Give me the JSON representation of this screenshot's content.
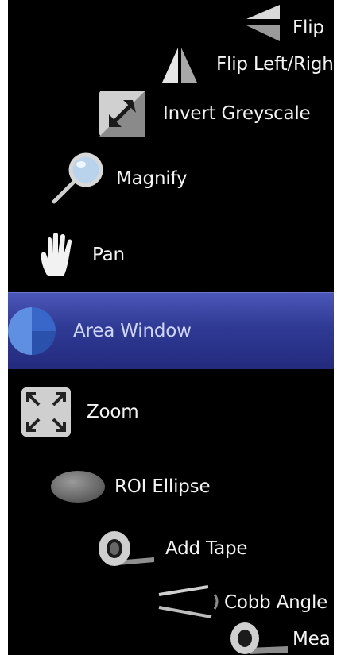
{
  "tools": {
    "flip_up_down": {
      "label": "Flip",
      "icon": "flip-up-down-icon"
    },
    "flip_left_right": {
      "label": "Flip Left/Right",
      "icon": "flip-left-right-icon"
    },
    "invert_greyscale": {
      "label": "Invert Greyscale",
      "icon": "invert-greyscale-icon"
    },
    "magnify": {
      "label": "Magnify",
      "icon": "magnify-icon"
    },
    "pan": {
      "label": "Pan",
      "icon": "hand-icon"
    },
    "area_window": {
      "label": "Area Window",
      "icon": "area-window-icon",
      "selected": true
    },
    "zoom": {
      "label": "Zoom",
      "icon": "zoom-icon"
    },
    "roi_ellipse": {
      "label": "ROI Ellipse",
      "icon": "ellipse-icon"
    },
    "add_tape": {
      "label": "Add Tape",
      "icon": "tape-icon"
    },
    "cobb_angle": {
      "label": "Cobb Angle",
      "icon": "cobb-angle-icon"
    },
    "measure": {
      "label": "Mea",
      "icon": "measure-tape-icon"
    }
  },
  "colors": {
    "panel_background": "#000000",
    "selected_background": "#2f3a94",
    "selected_text": "#cfd6ff",
    "text": "#f4f4f4"
  }
}
